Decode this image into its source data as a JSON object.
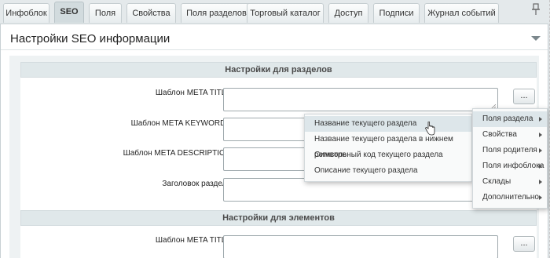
{
  "tabs": [
    {
      "label": "Инфоблок",
      "active": false
    },
    {
      "label": "SEO",
      "active": true
    },
    {
      "label": "Поля",
      "active": false
    },
    {
      "label": "Свойства",
      "active": false
    },
    {
      "label": "Поля разделов",
      "active": false
    },
    {
      "label": "Торговый каталог",
      "active": false
    },
    {
      "label": "Доступ",
      "active": false
    },
    {
      "label": "Подписи",
      "active": false
    },
    {
      "label": "Журнал событий",
      "active": false
    }
  ],
  "panel": {
    "title": "Настройки SEO информации"
  },
  "sections": {
    "sections_head": "Настройки для разделов",
    "elements_head": "Настройки для элементов"
  },
  "fields": {
    "meta_title": "Шаблон META TITLE",
    "meta_keywords": "Шаблон META KEYWORDS",
    "meta_description": "Шаблон META DESCRIPTION",
    "section_heading": "Заголовок раздела",
    "elem_meta_title": "Шаблон META TITLE"
  },
  "buttons": {
    "dots": "..."
  },
  "main_menu": {
    "items": [
      {
        "label": "Поля раздела",
        "submenu": true,
        "hover": true
      },
      {
        "label": "Свойства",
        "submenu": true
      },
      {
        "label": "Поля родителя",
        "submenu": true
      },
      {
        "label": "Поля инфоблока",
        "submenu": true
      },
      {
        "label": "Склады",
        "submenu": true
      },
      {
        "label": "Дополнительно",
        "submenu": true
      }
    ]
  },
  "sub_menu": {
    "items": [
      {
        "label": "Название текущего раздела",
        "hover": true
      },
      {
        "label": "Название текущего раздела в нижнем регистре"
      },
      {
        "label": "Символьный код текущего раздела"
      },
      {
        "label": "Описание текущего раздела"
      }
    ]
  },
  "colors": {
    "background": "#e4e9eb",
    "section_header": "#e0e8ea",
    "menu_hover": "#dde6ea"
  }
}
